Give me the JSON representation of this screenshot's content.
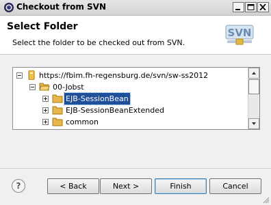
{
  "window": {
    "title": "Checkout from SVN",
    "controls": [
      "minimize",
      "maximize",
      "close"
    ]
  },
  "banner": {
    "title": "Select Folder",
    "description": "Select the folder to be checked out from SVN.",
    "logo_text": "SVN"
  },
  "tree": {
    "rows": [
      {
        "label": "https://fbim.fh-regensburg.de/svn/sw-ss2012",
        "icon": "repository-icon",
        "state": "expanded",
        "selected": false
      },
      {
        "label": "00-Jobst",
        "icon": "folder-open-icon",
        "state": "expanded",
        "selected": false
      },
      {
        "label": "EJB-SessionBean",
        "icon": "folder-icon",
        "state": "collapsed",
        "selected": true
      },
      {
        "label": "EJB-SessionBeanExtended",
        "icon": "folder-icon",
        "state": "collapsed",
        "selected": false
      },
      {
        "label": "common",
        "icon": "folder-icon",
        "state": "collapsed",
        "selected": false
      }
    ]
  },
  "buttons": {
    "help": "?",
    "back": "< Back",
    "next": "Next >",
    "finish": "Finish",
    "cancel": "Cancel"
  },
  "colors": {
    "selection": "#1e4f9a",
    "folder": "#e8b64a"
  }
}
